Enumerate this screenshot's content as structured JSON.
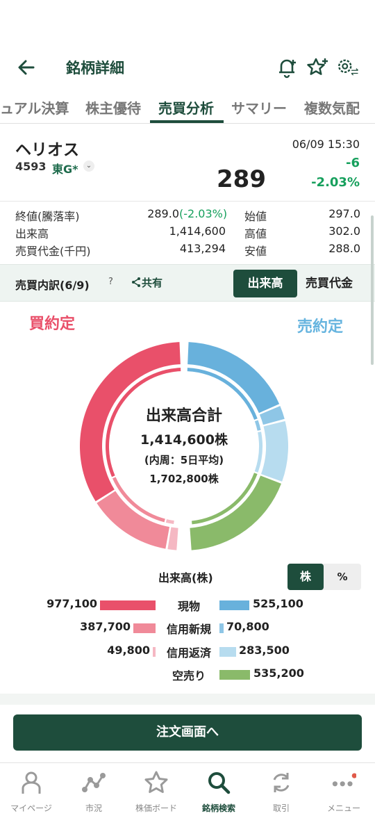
{
  "header": {
    "title": "銘柄詳細"
  },
  "tabs": [
    {
      "label": "ュアル決算"
    },
    {
      "label": "株主優待"
    },
    {
      "label": "売買分析"
    },
    {
      "label": "サマリー"
    },
    {
      "label": "複数気配"
    }
  ],
  "stock": {
    "name": "ヘリオス",
    "code": "4593",
    "market": "東G*",
    "time": "06/09 15:30",
    "price": "289",
    "change": "-6",
    "change_pct": "-2.03%"
  },
  "stats": {
    "close_label": "終値(騰落率)",
    "close_value": "289.0",
    "close_pct": "(-2.03%)",
    "volume_label": "出来高",
    "volume_value": "1,414,600",
    "turnover_label": "売買代金(千円)",
    "turnover_value": "413,294",
    "open_label": "始値",
    "open_value": "297.0",
    "high_label": "高値",
    "high_value": "302.0",
    "low_label": "安値",
    "low_value": "288.0"
  },
  "breakdown": {
    "title": "売買内訳(6/9)",
    "help": "?",
    "share": "共有",
    "seg_volume": "出来高",
    "seg_turnover": "売買代金"
  },
  "donut_section": {
    "buy_label": "買約定",
    "sell_label": "売約定",
    "center_title": "出来高合計",
    "center_total": "1,414,600株",
    "center_note": "(内周：5日平均)",
    "center_avg": "1,702,800株"
  },
  "legend": {
    "title": "出来高(株)",
    "unit_on": "株",
    "unit_off": "%",
    "rows": [
      {
        "category": "現物",
        "buy": "977,100",
        "sell": "525,100"
      },
      {
        "category": "信用新規",
        "buy": "387,700",
        "sell": "70,800"
      },
      {
        "category": "信用返済",
        "buy": "49,800",
        "sell": "283,500"
      },
      {
        "category": "空売り",
        "buy": "",
        "sell": "535,200"
      }
    ]
  },
  "chart_data": {
    "type": "pie",
    "title": "出来高合計",
    "buy": [
      {
        "name": "現物",
        "value": 977100
      },
      {
        "name": "信用新規",
        "value": 387700
      },
      {
        "name": "信用返済",
        "value": 49800
      }
    ],
    "sell": [
      {
        "name": "現物",
        "value": 525100
      },
      {
        "name": "信用新規",
        "value": 70800
      },
      {
        "name": "信用返済",
        "value": 283500
      },
      {
        "name": "空売り",
        "value": 535200
      }
    ],
    "total": 1414600,
    "inner_ring_5day_avg": 1702800
  },
  "colors": {
    "brand": "#1e4d3c",
    "buy_cash": "#e9506a",
    "buy_margin_new": "#f08a99",
    "buy_margin_repay": "#f5b8c3",
    "sell_cash": "#68b1dc",
    "sell_margin_new": "#8ec6e6",
    "sell_margin_repay": "#b7dcef",
    "short_sell": "#8aba6a",
    "down": "#17a05d"
  },
  "order_button": {
    "label": "注文画面へ"
  },
  "nav": [
    {
      "label": "マイページ",
      "icon": "person-icon"
    },
    {
      "label": "市況",
      "icon": "chart-nodes-icon"
    },
    {
      "label": "株価ボード",
      "icon": "star-icon"
    },
    {
      "label": "銘柄検索",
      "icon": "search-icon",
      "active": true
    },
    {
      "label": "取引",
      "icon": "recycle-icon"
    },
    {
      "label": "メニュー",
      "icon": "more-icon"
    }
  ]
}
